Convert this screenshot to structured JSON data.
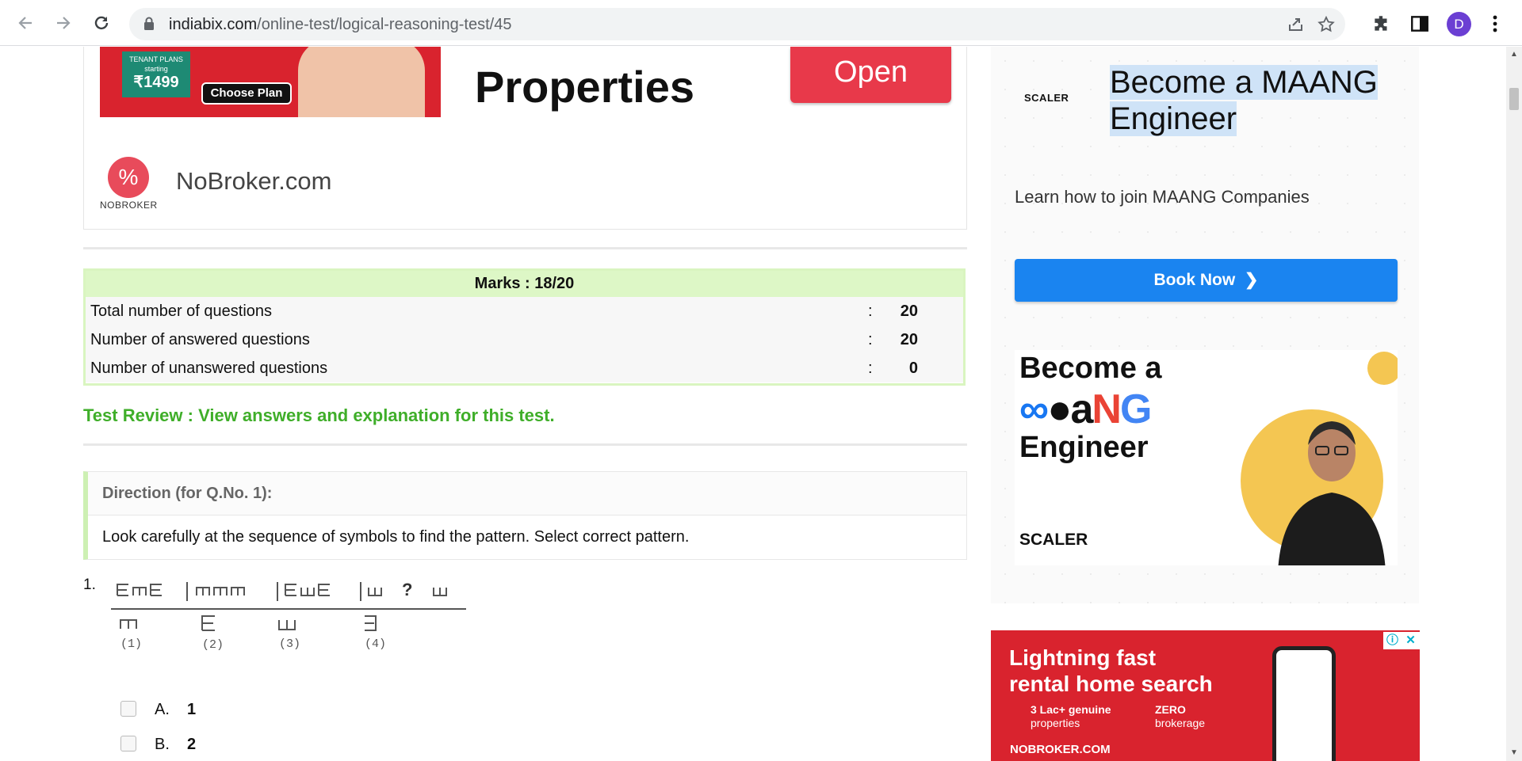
{
  "browser": {
    "url_domain": "indiabix.com",
    "url_path": "/online-test/logical-reasoning-test/45",
    "profile_initial": "D"
  },
  "top_ad": {
    "badge_label": "TENANT PLANS",
    "badge_starting": "starting",
    "badge_price": "₹1499",
    "choose_plan": "Choose Plan",
    "headline": "Properties",
    "open_button": "Open",
    "logo_text": "NOBROKER",
    "brand": "NoBroker.com"
  },
  "marks": {
    "header": "Marks : 18/20",
    "rows": [
      {
        "label": "Total number of questions",
        "value": "20"
      },
      {
        "label": "Number of answered questions",
        "value": "20"
      },
      {
        "label": "Number of unanswered questions",
        "value": "0"
      }
    ],
    "colon": ":"
  },
  "review_link": "Test Review : View answers and explanation for this test.",
  "direction": {
    "title": "Direction (for Q.No. 1):",
    "text": "Look carefully at the sequence of symbols to find the pattern. Select correct pattern."
  },
  "question": {
    "number": "1.",
    "options": [
      {
        "letter": "A.",
        "value": "1"
      },
      {
        "letter": "B.",
        "value": "2"
      }
    ]
  },
  "side_ad": {
    "scaler_mini": "SCALER",
    "title_line1": "Become a MAANG",
    "title_line2": "Engineer",
    "subtitle": "Learn how to join MAANG Companies",
    "book_button": "Book Now",
    "card_line1": "Become a",
    "card_line2": "Engineer",
    "card_brand": "SCALER"
  },
  "bottom_ad": {
    "title_line1": "Lightning fast",
    "title_line2": "rental home search",
    "feature1_line1": "3 Lac+ genuine",
    "feature1_line2": "properties",
    "feature2_line1": "ZERO",
    "feature2_line2": "brokerage",
    "brand": "NOBROKER.COM"
  },
  "colors": {
    "accent_green": "#3fae29",
    "marks_header_bg": "#ddf7c6",
    "book_button_bg": "#1a84f0",
    "nobroker_red": "#d9232e",
    "open_button_bg": "#e8394a"
  }
}
